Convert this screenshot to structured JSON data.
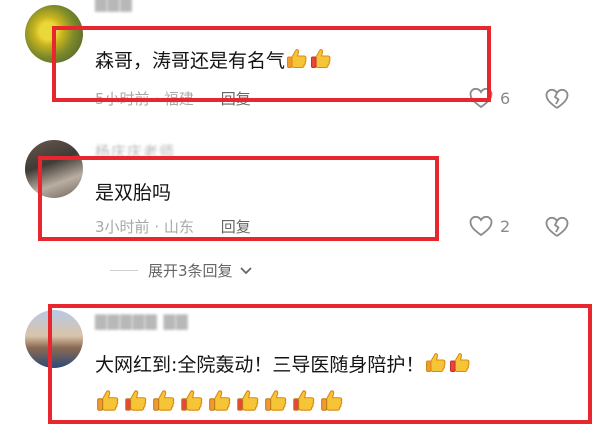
{
  "comments": [
    {
      "username": "▇▇▇",
      "content": "森哥，涛哥还是有名气",
      "time": "5小时前",
      "separator": "·",
      "location": "福建",
      "reply_label": "回复",
      "likes": "6",
      "trailing_emoji_count": 2
    },
    {
      "username": "杨庆庆老师",
      "content": "是双胎吗",
      "time": "3小时前",
      "separator": "·",
      "location": "山东",
      "reply_label": "回复",
      "likes": "2",
      "expand_label": "展开3条回复"
    },
    {
      "username": "▇▇▇▇▇ ▇▇",
      "content": "大网红到:全院轰动！三导医随身陪护！",
      "trailing_emoji_count": 2,
      "second_line_emoji_count": 9
    }
  ],
  "icons": {
    "like": "heart-outline-icon",
    "dislike": "broken-heart-icon",
    "emoji": "thumbs-up-emoji"
  },
  "colors": {
    "highlight_box": "#e8262d",
    "meta_text": "#a8a8a8",
    "reply_text": "#666666"
  }
}
